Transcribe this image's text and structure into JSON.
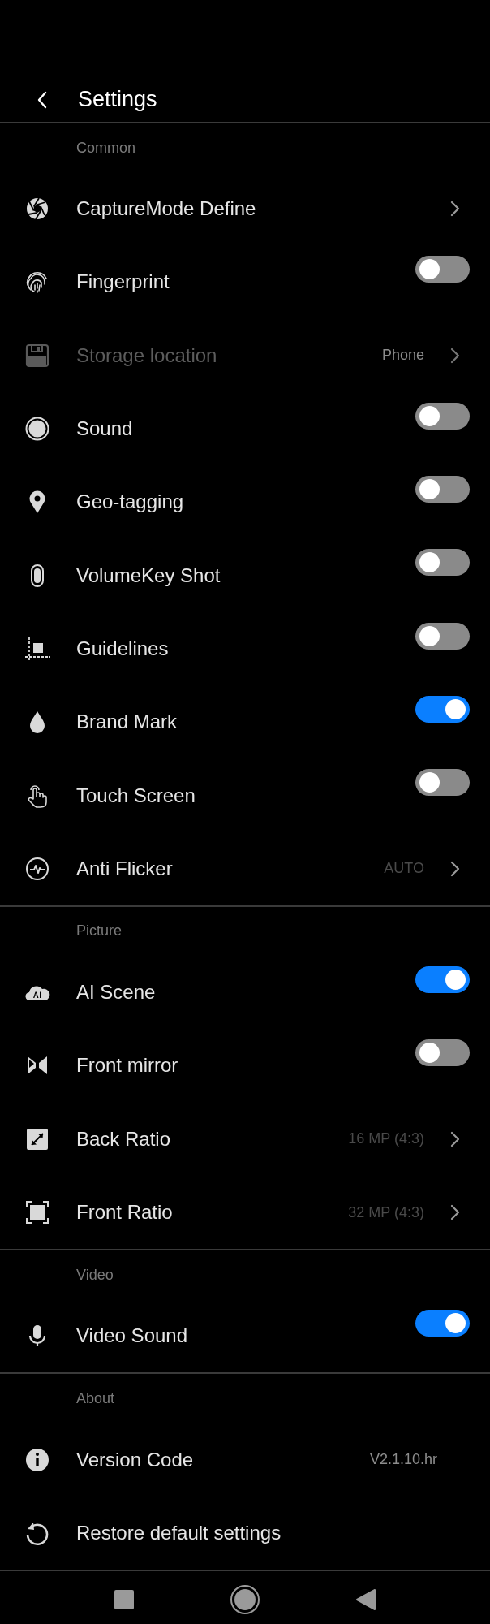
{
  "header": {
    "title": "Settings"
  },
  "sections": [
    {
      "title": "Common",
      "rows": [
        {
          "label": "CaptureMode Define",
          "kind": "link",
          "disabled": false
        },
        {
          "label": "Fingerprint",
          "kind": "toggle",
          "on": false
        },
        {
          "label": "Storage location",
          "kind": "link",
          "value": "Phone",
          "dimmed": false,
          "disabled": true
        },
        {
          "label": "Sound",
          "kind": "toggle",
          "on": false
        },
        {
          "label": "Geo-tagging",
          "kind": "toggle",
          "on": false
        },
        {
          "label": "VolumeKey Shot",
          "kind": "toggle",
          "on": false
        },
        {
          "label": "Guidelines",
          "kind": "toggle",
          "on": false
        },
        {
          "label": "Brand Mark",
          "kind": "toggle",
          "on": true
        },
        {
          "label": "Touch Screen",
          "kind": "toggle",
          "on": false
        },
        {
          "label": "Anti Flicker",
          "kind": "link",
          "value": "AUTO",
          "dimmed": true,
          "disabled": false
        }
      ]
    },
    {
      "title": "Picture",
      "rows": [
        {
          "label": "AI Scene",
          "kind": "toggle",
          "on": true
        },
        {
          "label": "Front mirror",
          "kind": "toggle",
          "on": false
        },
        {
          "label": "Back Ratio",
          "kind": "link",
          "value": "16 MP (4:3)",
          "dimmed": true,
          "disabled": false
        },
        {
          "label": "Front Ratio",
          "kind": "link",
          "value": "32 MP (4:3)",
          "dimmed": true,
          "disabled": false
        }
      ]
    },
    {
      "title": "Video",
      "rows": [
        {
          "label": "Video Sound",
          "kind": "toggle",
          "on": true
        }
      ]
    },
    {
      "title": "About",
      "rows": [
        {
          "label": "Version Code",
          "kind": "info",
          "value": "V2.1.10.hr",
          "dimmed": false
        },
        {
          "label": "Restore default settings",
          "kind": "action"
        }
      ]
    }
  ]
}
